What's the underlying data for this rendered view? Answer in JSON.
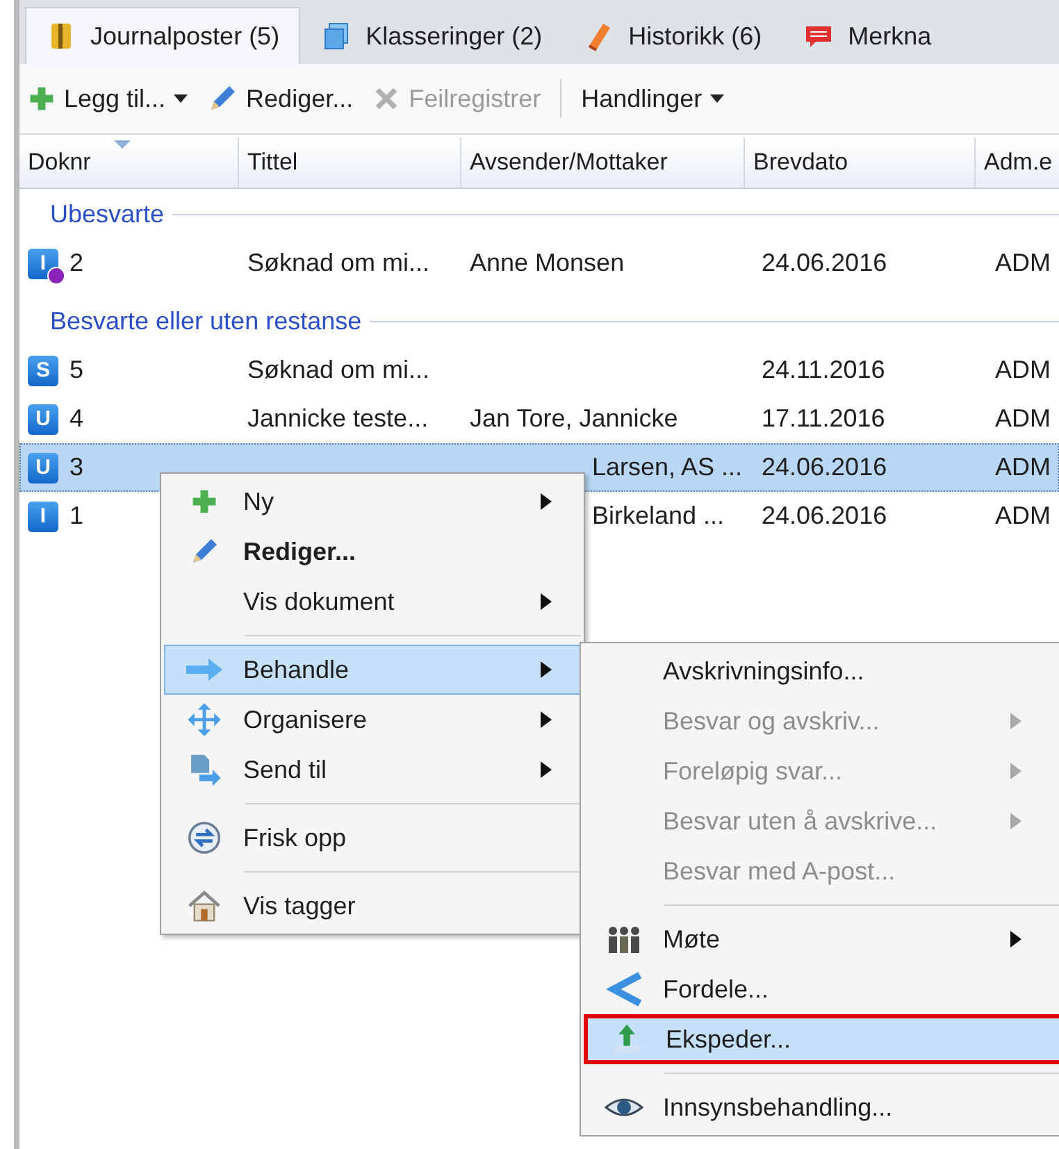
{
  "tabs": [
    {
      "label": "Journalposter (5)",
      "selected": true
    },
    {
      "label": "Klasseringer (2)",
      "selected": false
    },
    {
      "label": "Historikk (6)",
      "selected": false
    },
    {
      "label": "Merkna",
      "selected": false
    }
  ],
  "toolbar": [
    {
      "kind": "dropdown",
      "label": "Legg til...",
      "disabled": false
    },
    {
      "kind": "button",
      "label": "Rediger...",
      "disabled": false
    },
    {
      "kind": "button",
      "label": "Feilregistrer",
      "disabled": true
    },
    {
      "kind": "separator"
    },
    {
      "kind": "dropdown",
      "label": "Handlinger",
      "disabled": false
    }
  ],
  "table": {
    "columns": [
      "Doknr",
      "Tittel",
      "Avsender/Mottaker",
      "Brevdato",
      "Adm.e"
    ],
    "groups": [
      {
        "label": "Ubesvarte",
        "rows": [
          {
            "badge": "I",
            "warning": true,
            "doknr": "2",
            "title": "Søknad om mi...",
            "sender": "Anne Monsen",
            "date": "24.06.2016",
            "adm": "ADM",
            "selected": false
          }
        ]
      },
      {
        "label": "Besvarte eller uten restanse",
        "rows": [
          {
            "badge": "S",
            "warning": false,
            "doknr": "5",
            "title": "Søknad om mi...",
            "date": "24.11.2016",
            "adm": "ADM",
            "selected": false
          },
          {
            "badge": "U",
            "warning": false,
            "doknr": "4",
            "title": "Jannicke teste...",
            "sender": "Jan Tore, Jannicke",
            "date": "17.11.2016",
            "adm": "ADM",
            "selected": false
          },
          {
            "badge": "U",
            "warning": false,
            "doknr": "3",
            "sender": "Larsen, AS ...",
            "date": "24.06.2016",
            "adm": "ADM",
            "selected": true
          },
          {
            "badge": "I",
            "warning": false,
            "doknr": "1",
            "sender": "Birkeland ...",
            "date": "24.06.2016",
            "adm": "ADM",
            "selected": false
          }
        ]
      }
    ]
  },
  "context_menu": {
    "items": [
      {
        "kind": "item",
        "label": "Ny",
        "bold": false,
        "submenu": true,
        "selected": false
      },
      {
        "kind": "item",
        "label": "Rediger...",
        "bold": true,
        "submenu": false,
        "selected": false
      },
      {
        "kind": "item",
        "label": "Vis dokument",
        "bold": false,
        "submenu": true,
        "selected": false
      },
      {
        "kind": "separator"
      },
      {
        "kind": "item",
        "label": "Behandle",
        "bold": false,
        "submenu": true,
        "selected": true
      },
      {
        "kind": "item",
        "label": "Organisere",
        "bold": false,
        "submenu": true,
        "selected": false
      },
      {
        "kind": "item",
        "label": "Send til",
        "bold": false,
        "submenu": true,
        "selected": false
      },
      {
        "kind": "separator"
      },
      {
        "kind": "item",
        "label": "Frisk opp",
        "bold": false,
        "submenu": false,
        "selected": false
      },
      {
        "kind": "separator"
      },
      {
        "kind": "item",
        "label": "Vis tagger",
        "bold": false,
        "submenu": false,
        "selected": false
      }
    ]
  },
  "submenu": {
    "items": [
      {
        "kind": "item",
        "label": "Avskrivningsinfo...",
        "disabled": false,
        "submenu": false,
        "selected": false
      },
      {
        "kind": "item",
        "label": "Besvar og avskriv...",
        "disabled": true,
        "submenu": true,
        "selected": false
      },
      {
        "kind": "item",
        "label": "Foreløpig svar...",
        "disabled": true,
        "submenu": true,
        "selected": false
      },
      {
        "kind": "item",
        "label": "Besvar uten å avskrive...",
        "disabled": true,
        "submenu": true,
        "selected": false
      },
      {
        "kind": "item",
        "label": "Besvar med A-post...",
        "disabled": true,
        "submenu": false,
        "selected": false
      },
      {
        "kind": "separator"
      },
      {
        "kind": "item",
        "label": "Møte",
        "disabled": false,
        "submenu": true,
        "selected": false
      },
      {
        "kind": "item",
        "label": "Fordele...",
        "disabled": false,
        "submenu": false,
        "selected": false
      },
      {
        "kind": "item",
        "label": "Ekspeder...",
        "disabled": false,
        "submenu": false,
        "selected": true
      },
      {
        "kind": "separator"
      },
      {
        "kind": "item",
        "label": "Innsynsbehandling...",
        "disabled": false,
        "submenu": false,
        "selected": false
      }
    ]
  }
}
